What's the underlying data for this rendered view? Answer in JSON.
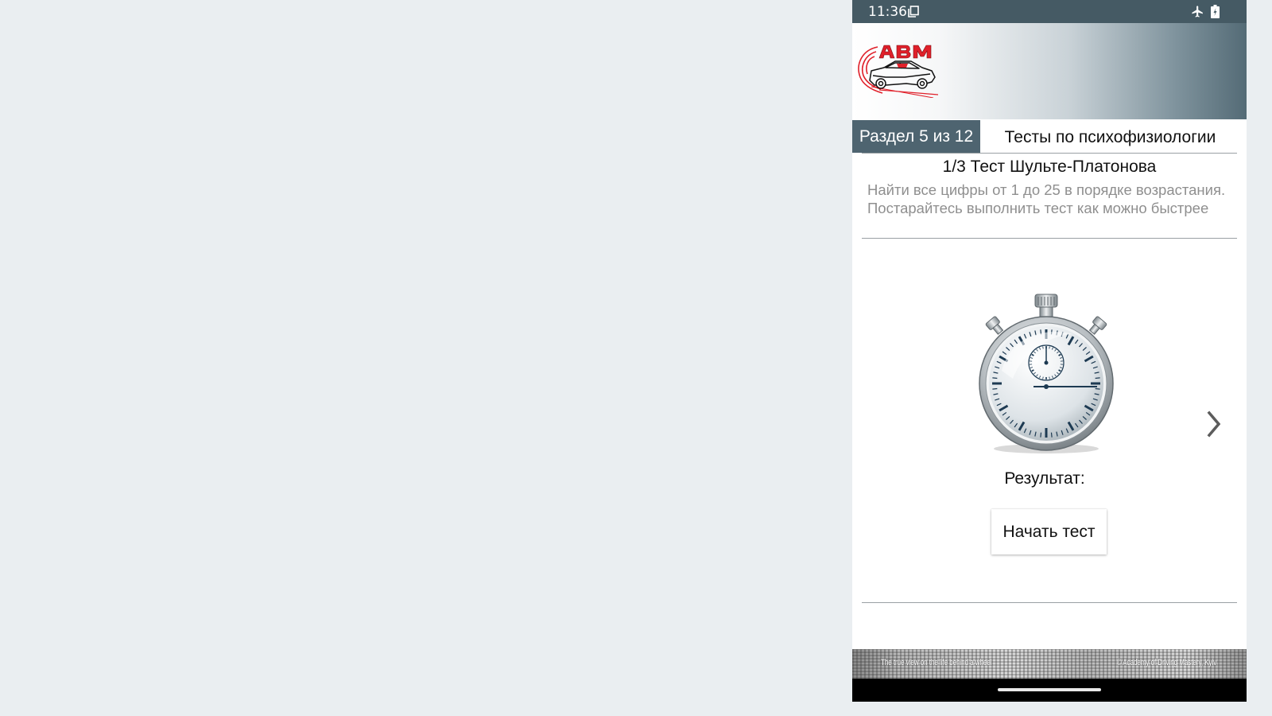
{
  "status_bar": {
    "time": "11:36",
    "icons": [
      "copy-icon",
      "airplane-icon",
      "battery-icon"
    ]
  },
  "header": {
    "logo_text": "ABM",
    "logo_color": "#e0202a"
  },
  "section": {
    "badge": "Раздел 5 из 12",
    "title": "Тесты по психофизиологии"
  },
  "test": {
    "title": "1/3 Тест Шульте-Платонова",
    "description": "Найти все цифры от 1 до 25 в порядке возрастания. Постарайтесь выполнить тест как можно быстрее",
    "result_label": "Результат:",
    "start_button": "Начать тест"
  },
  "footer": {
    "left_text": "The true view on the life behind a wheel",
    "right_text": "© Academy of Driving Mastery, Kyiv"
  },
  "colors": {
    "status_bar": "#455a64",
    "section_badge": "#4e6470",
    "description_text": "#8f8f8f",
    "page_background": "#eaeef1"
  }
}
